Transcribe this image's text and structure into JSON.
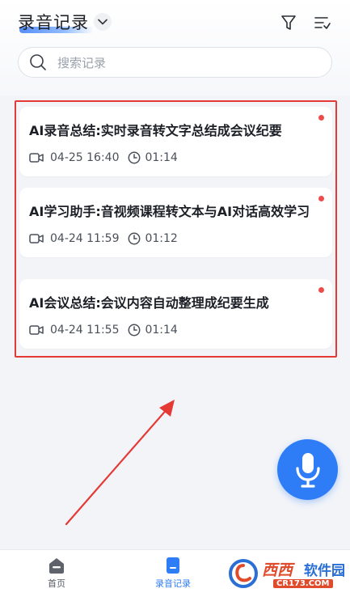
{
  "header": {
    "title": "录音记录",
    "icons": [
      "chevron-down-icon",
      "filter-icon",
      "sort-list-icon"
    ]
  },
  "search": {
    "placeholder": "搜索记录"
  },
  "records": [
    {
      "title": "AI录音总结:实时录音转文字总结成会议纪要",
      "date": "04-25 16:40",
      "duration": "01:14",
      "unread": true
    },
    {
      "title": "AI学习助手:音视频课程转文本与AI对话高效学习",
      "date": "04-24 11:59",
      "duration": "01:12",
      "unread": true
    },
    {
      "title": "AI会议总结:会议内容自动整理成纪要生成",
      "date": "04-24 11:55",
      "duration": "01:14",
      "unread": true
    }
  ],
  "fab": {
    "icon": "microphone-icon"
  },
  "bottom_nav": {
    "items": [
      {
        "label": "首页",
        "icon": "home-icon",
        "active": false
      },
      {
        "label": "录音记录",
        "icon": "document-icon",
        "active": true
      }
    ]
  },
  "watermark": {
    "brand_red": "西西",
    "brand_blue": "软件园",
    "url": "CR173.COM"
  },
  "colors": {
    "accent": "#2f7df6",
    "annotation": "#e53935",
    "unread_dot": "#f04b4b"
  }
}
